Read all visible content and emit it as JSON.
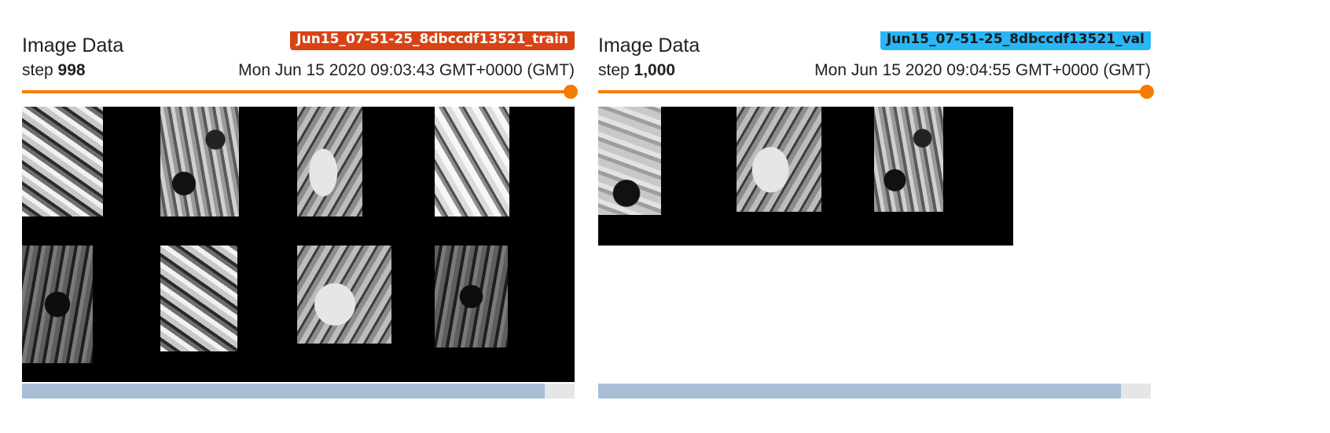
{
  "cards": [
    {
      "run_name": "Jun15_07-51-25_8dbccdf13521_train",
      "run_color": "#d84315",
      "tag": "Image Data",
      "step_label": "step",
      "step_value": "998",
      "wall_time": "Mon Jun 15 2020 09:03:43 GMT+0000 (GMT)",
      "slider_value": 1.0,
      "scroll_visible_fraction": 0.946,
      "image_alt": "8 image tiles"
    },
    {
      "run_name": "Jun15_07-51-25_8dbccdf13521_val",
      "run_color": "#29b6f6",
      "tag": "Image Data",
      "step_label": "step",
      "step_value": "1,000",
      "wall_time": "Mon Jun 15 2020 09:04:55 GMT+0000 (GMT)",
      "slider_value": 1.0,
      "scroll_visible_fraction": 0.946,
      "image_alt": "3 image tiles"
    }
  ],
  "colors": {
    "slider": "#f57c00",
    "scrollbar_thumb": "#a7bed6",
    "scrollbar_track": "#e6e6e6"
  }
}
